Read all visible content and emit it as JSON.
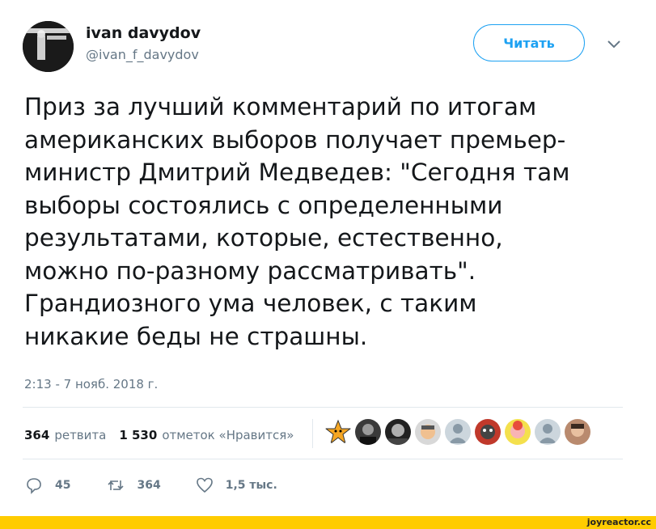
{
  "user": {
    "name": "ivan davydov",
    "handle": "@ivan_f_davydov",
    "avatar_icon": "avatar-photo-icon"
  },
  "follow_button": {
    "label": "Читать",
    "color": "#1da1f2"
  },
  "menu_icon": "chevron-down-icon",
  "tweet": {
    "text": "Приз за лучший комментарий по итогам\nамериканских выборов получает премьер-\nминистр Дмитрий Медведев: \"Сегодня там\nвыборы состоялись с определенными\nрезультатами, которые, естественно,\nможно по-разному рассматривать\".\nГрандиозного ума человек, с таким\nникакие беды не страшны.",
    "timestamp": "2:13 - 7 нояб. 2018 г."
  },
  "stats": {
    "retweets_count": "364",
    "retweets_label": "ретвита",
    "likes_count": "1 530",
    "likes_label": "отметок «Нравится»"
  },
  "likers": [
    {
      "icon": "star-avatar-icon",
      "bg": "#ffffff"
    },
    {
      "icon": "person-avatar-icon",
      "bg": "#333333"
    },
    {
      "icon": "person-avatar-icon",
      "bg": "#2a2a2a"
    },
    {
      "icon": "cartoon-avatar-icon",
      "bg": "#d8d8d8"
    },
    {
      "icon": "default-avatar-icon",
      "bg": "#ccd6dd"
    },
    {
      "icon": "cartoon-avatar-icon",
      "bg": "#c0392b"
    },
    {
      "icon": "cartoon-avatar-icon",
      "bg": "#f4e04d"
    },
    {
      "icon": "default-avatar-icon",
      "bg": "#ccd6dd"
    },
    {
      "icon": "person-avatar-icon",
      "bg": "#b98a6e"
    }
  ],
  "actions": {
    "reply_count": "45",
    "retweet_count": "364",
    "like_count": "1,5 тыс."
  },
  "footer": {
    "watermark": "joyreactor.cc",
    "bar_color": "#ffcc00"
  }
}
